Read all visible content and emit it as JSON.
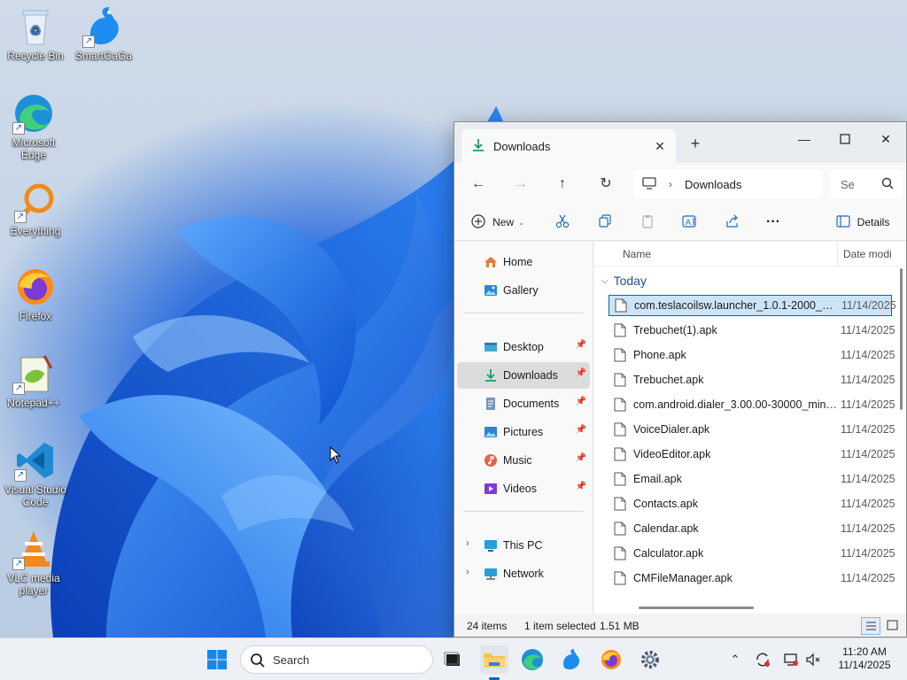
{
  "desktop": {
    "icons": [
      {
        "label": "Recycle Bin",
        "icon": "recycle-bin-icon"
      },
      {
        "label": "SmartGaGa",
        "icon": "smartgaga-icon"
      },
      {
        "label": "Microsoft Edge",
        "icon": "edge-icon"
      },
      {
        "label": "Everything",
        "icon": "everything-search-icon"
      },
      {
        "label": "Firefox",
        "icon": "firefox-icon"
      },
      {
        "label": "Notepad++",
        "icon": "notepadpp-icon"
      },
      {
        "label": "Visual Studio Code",
        "icon": "vscode-icon"
      },
      {
        "label": "VLC media player",
        "icon": "vlc-icon"
      }
    ]
  },
  "explorer": {
    "tab_title": "Downloads",
    "address": {
      "location": "Downloads"
    },
    "search": {
      "placeholder": "Se"
    },
    "commands": {
      "new_label": "New",
      "details_label": "Details"
    },
    "nav": {
      "home": "Home",
      "gallery": "Gallery",
      "desktop": "Desktop",
      "downloads": "Downloads",
      "documents": "Documents",
      "pictures": "Pictures",
      "music": "Music",
      "videos": "Videos",
      "this_pc": "This PC",
      "network": "Network"
    },
    "columns": {
      "name": "Name",
      "date": "Date modi"
    },
    "group": "Today",
    "files": [
      {
        "name": "com.teslacoilsw.launcher_1.0.1-2000_min...",
        "date": "11/14/2025",
        "selected": true
      },
      {
        "name": "Trebuchet(1).apk",
        "date": "11/14/2025"
      },
      {
        "name": "Phone.apk",
        "date": "11/14/2025"
      },
      {
        "name": "Trebuchet.apk",
        "date": "11/14/2025"
      },
      {
        "name": "com.android.dialer_3.00.00-30000_minAP...",
        "date": "11/14/2025"
      },
      {
        "name": "VoiceDialer.apk",
        "date": "11/14/2025"
      },
      {
        "name": "VideoEditor.apk",
        "date": "11/14/2025"
      },
      {
        "name": "Email.apk",
        "date": "11/14/2025"
      },
      {
        "name": "Contacts.apk",
        "date": "11/14/2025"
      },
      {
        "name": "Calendar.apk",
        "date": "11/14/2025"
      },
      {
        "name": "Calculator.apk",
        "date": "11/14/2025"
      },
      {
        "name": "CMFileManager.apk",
        "date": "11/14/2025"
      }
    ],
    "status": {
      "count": "24 items",
      "selected": "1 item selected",
      "size": "1.51 MB"
    }
  },
  "taskbar": {
    "search_label": "Search",
    "clock": {
      "time": "11:20 AM",
      "date": "11/14/2025"
    }
  },
  "colors": {
    "accent": "#0067c0",
    "selection_bg": "#cce4f7",
    "taskbar_bg": "#edf0f5"
  }
}
